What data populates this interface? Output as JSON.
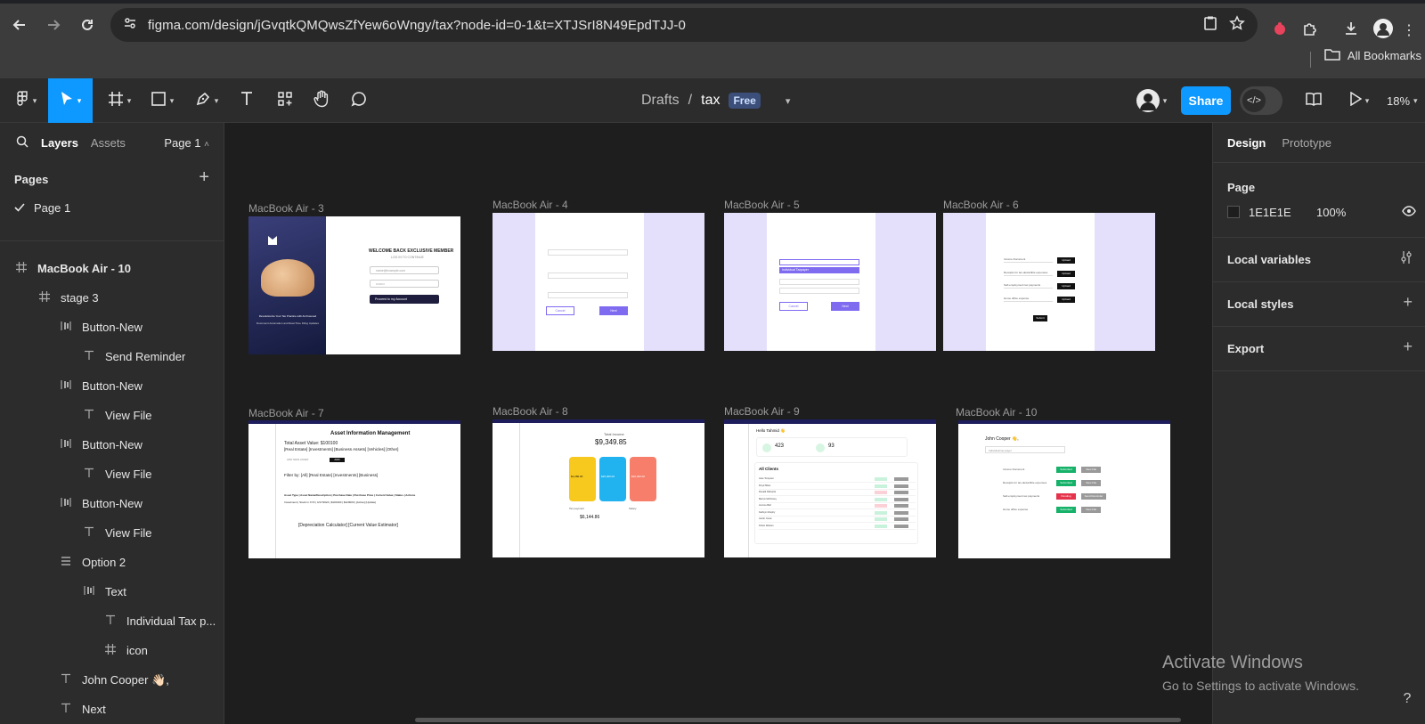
{
  "browser": {
    "url": "figma.com/design/jGvqtkQMQwsZfYew6oWngy/tax?node-id=0-1&t=XTJSrI8N49EpdTJJ-0",
    "all_bookmarks": "All Bookmarks"
  },
  "toolbar": {
    "breadcrumb_drafts": "Drafts",
    "breadcrumb_sep": "/",
    "file_name": "tax",
    "plan_badge": "Free",
    "share_label": "Share",
    "zoom": "18%"
  },
  "left_panel": {
    "tab_layers": "Layers",
    "tab_assets": "Assets",
    "page_selector": "Page 1",
    "pages_title": "Pages",
    "pages": [
      "Page 1"
    ],
    "layers": [
      {
        "label": "MacBook Air - 10",
        "icon": "frame-icon",
        "bold": true
      },
      {
        "label": "stage 3",
        "icon": "frame-icon"
      },
      {
        "label": "Button-New",
        "icon": "auto-layout-icon"
      },
      {
        "label": "Send Reminder",
        "icon": "text-icon"
      },
      {
        "label": "Button-New",
        "icon": "auto-layout-icon"
      },
      {
        "label": "View File",
        "icon": "text-icon"
      },
      {
        "label": "Button-New",
        "icon": "auto-layout-icon"
      },
      {
        "label": "View File",
        "icon": "text-icon"
      },
      {
        "label": "Button-New",
        "icon": "auto-layout-icon"
      },
      {
        "label": "View File",
        "icon": "text-icon"
      },
      {
        "label": "Option 2",
        "icon": "rows-icon"
      },
      {
        "label": "Text",
        "icon": "auto-layout-icon"
      },
      {
        "label": "Individual Tax p...",
        "icon": "text-icon"
      },
      {
        "label": "icon",
        "icon": "frame-icon"
      },
      {
        "label": "John Cooper 👋🏻,",
        "icon": "text-icon"
      },
      {
        "label": "Next",
        "icon": "text-icon"
      }
    ]
  },
  "frames": {
    "f3": {
      "title": "MacBook Air - 3",
      "heading": "WELCOME BACK EXCLUSIVE MEMBER",
      "subheading": "LOG IN TO CONTINUE",
      "email_placeholder": "name@example.com",
      "password_placeholder": "••••••••",
      "button": "Proceed to my Account",
      "tagline": "Revolutionize Your Tax Practice with AI-Powered",
      "tagline2": "Document Automation and Real-Time Filing Updates"
    },
    "f4": {
      "title": "MacBook Air - 4",
      "cancel": "Cancel",
      "next": "Next"
    },
    "f5": {
      "title": "MacBook Air - 5",
      "option_selected": "Individual Taxpayer",
      "cancel": "Cancel",
      "next": "Next"
    },
    "f6": {
      "title": "MacBook Air - 6",
      "rows": [
        "Income Document",
        "Receipts for tax-deductible expenses",
        "Self-employment tax payments",
        "Home office expense"
      ],
      "upload": "Upload",
      "submit": "Submit"
    },
    "f7": {
      "title": "MacBook Air - 7",
      "heading": "Asset Information Management",
      "total": "Total Asset Value: $100100",
      "categories": "[Real Estate] [Investments] [Business Assets] [Vehicles] [Other]",
      "add_placeholder": "ADD NEW ASSET",
      "add_btn": "ADD",
      "filter": "Filter by: [All] [Real Estate] [Investments] [Business]",
      "table_head": "Asset Type | Asset Name/Description | Purchase Date | Purchase Price | Current Value | Status | Actions",
      "table_row": "Investment | Stock in XYZ | 4/17/2024 | $100100 | $120000 | [Active] [Update]",
      "footer": "[Depreciation Calculator] [Current Value Estimator]"
    },
    "f8": {
      "title": "MacBook Air - 8",
      "label": "Total Income",
      "amount": "$9,349.85",
      "card1": "$1,280.00",
      "card2": "$20,000.00",
      "card3": "$20,000.00",
      "tax_label": "Tax payment",
      "tax_amount": "$6,144.86",
      "salary": "Salary"
    },
    "f9": {
      "title": "MacBook Air - 9",
      "greeting": "Hello Tahmid 👋",
      "stat1": "423",
      "stat2": "93",
      "clients_title": "All Clients",
      "clients": [
        "Jane Tompson",
        "Floyd Miles",
        "Ronald Richards",
        "Marvin McKinney",
        "Jerome Bell",
        "Kathryn Murphy",
        "Jacob Jones",
        "Kristin Watson"
      ]
    },
    "f10": {
      "title": "MacBook Air - 10",
      "greeting": "John Cooper 👋,",
      "subtitle": "Individual tax payer",
      "rows": [
        {
          "label": "Income Document",
          "status": "Submitted",
          "action": "View File"
        },
        {
          "label": "Receipts for tax-deductible expenses",
          "status": "Submitted",
          "action": "View File"
        },
        {
          "label": "Self-employment tax payments",
          "status": "Pending",
          "action": "Send Reminder"
        },
        {
          "label": "Home office expense",
          "status": "Submitted",
          "action": "View File"
        }
      ]
    }
  },
  "right_panel": {
    "tab_design": "Design",
    "tab_prototype": "Prototype",
    "page_section": "Page",
    "bg_color": "1E1E1E",
    "bg_opacity": "100%",
    "local_variables": "Local variables",
    "local_styles": "Local styles",
    "export": "Export"
  },
  "os": {
    "activate_title": "Activate Windows",
    "activate_sub": "Go to Settings to activate Windows.",
    "help": "?"
  },
  "colors": {
    "accent": "#0d99ff",
    "canvas": "#1e1e1e",
    "panel": "#2c2c2c",
    "lavender": "#e4e0fb",
    "purple": "#7e6bf0",
    "green": "#17b26a",
    "pending": "#e5334b"
  }
}
